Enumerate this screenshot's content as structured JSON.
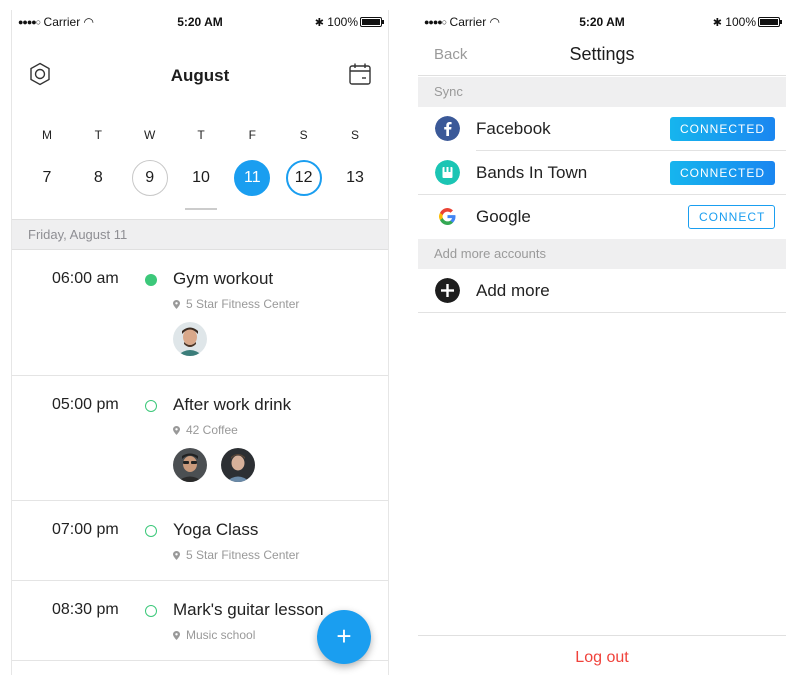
{
  "left_screen": {
    "status": {
      "carrier": "Carrier",
      "time": "5:20 AM",
      "battery": "100%"
    },
    "header": {
      "title": "August",
      "left_icon": "settings-icon",
      "right_icon": "calendar-icon"
    },
    "weekdays": [
      "M",
      "T",
      "W",
      "T",
      "F",
      "S",
      "S"
    ],
    "days": [
      "7",
      "8",
      "9",
      "10",
      "11",
      "12",
      "13"
    ],
    "date_header": "Friday, August 11",
    "events": [
      {
        "time": "06:00 am",
        "title": "Gym workout",
        "location": "5 Star Fitness Center",
        "done": true
      },
      {
        "time": "05:00 pm",
        "title": "After work drink",
        "location": "42 Coffee",
        "done": false
      },
      {
        "time": "07:00 pm",
        "title": "Yoga Class",
        "location": "5 Star Fitness Center",
        "done": false
      },
      {
        "time": "08:30 pm",
        "title": "Mark's guitar lesson",
        "location": "Music school",
        "done": false
      }
    ],
    "fab_label": "+"
  },
  "right_screen": {
    "status": {
      "carrier": "Carrier",
      "time": "5:20 AM",
      "battery": "100%"
    },
    "nav": {
      "back": "Back",
      "title": "Settings"
    },
    "sync_header": "Sync",
    "accounts": [
      {
        "name": "Facebook",
        "button": "CONNECTED",
        "icon": "facebook-icon",
        "color": "#3b5998"
      },
      {
        "name": "Bands In Town",
        "button": "CONNECTED",
        "icon": "bandsintown-icon",
        "color": "#1bc5b4"
      },
      {
        "name": "Google",
        "button": "CONNECT",
        "icon": "google-icon",
        "color": "#4285f4"
      }
    ],
    "add_header": "Add more accounts",
    "add_more": "Add more",
    "logout": "Log out"
  },
  "colors": {
    "accent": "#1a9ef0",
    "done": "#3cc87a",
    "logout": "#f0423b"
  }
}
